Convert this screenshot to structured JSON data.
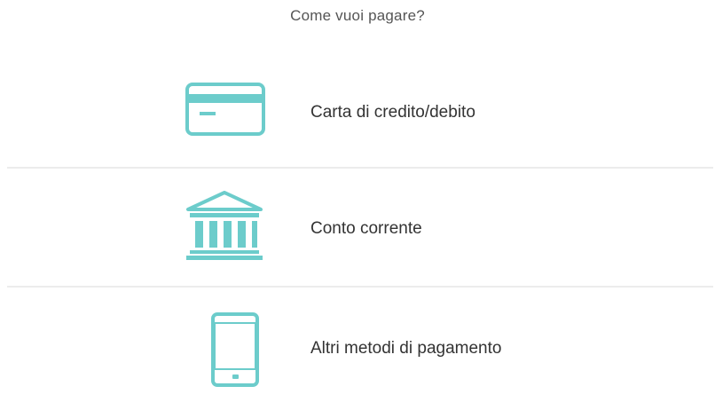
{
  "heading": "Come vuoi pagare?",
  "accent_color": "#6ccccb",
  "options": [
    {
      "label": "Carta di credito/debito",
      "icon": "credit-card-icon"
    },
    {
      "label": "Conto corrente",
      "icon": "bank-icon"
    },
    {
      "label": "Altri metodi di pagamento",
      "icon": "smartphone-icon"
    }
  ]
}
